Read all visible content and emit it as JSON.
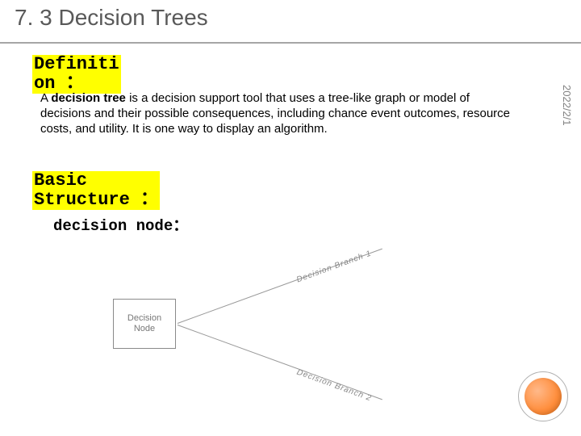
{
  "slide": {
    "title": "7. 3 Decision Trees",
    "definition_label": "Definiti\non ：",
    "definition_a": "A ",
    "definition_term": "decision tree",
    "definition_rest": " is a decision support tool that uses a tree-like graph or model of decisions and their possible consequences, including chance event outcomes, resource costs, and utility. It is one way to display an algorithm.",
    "structure_label": "Basic\nStructure ：",
    "decision_node_label": "decision node：",
    "diagram": {
      "node_text": "Decision\nNode",
      "branch1_label": "Decision Branch 1",
      "branch2_label": "Decision Branch 2"
    },
    "date": "2022/2/1"
  }
}
